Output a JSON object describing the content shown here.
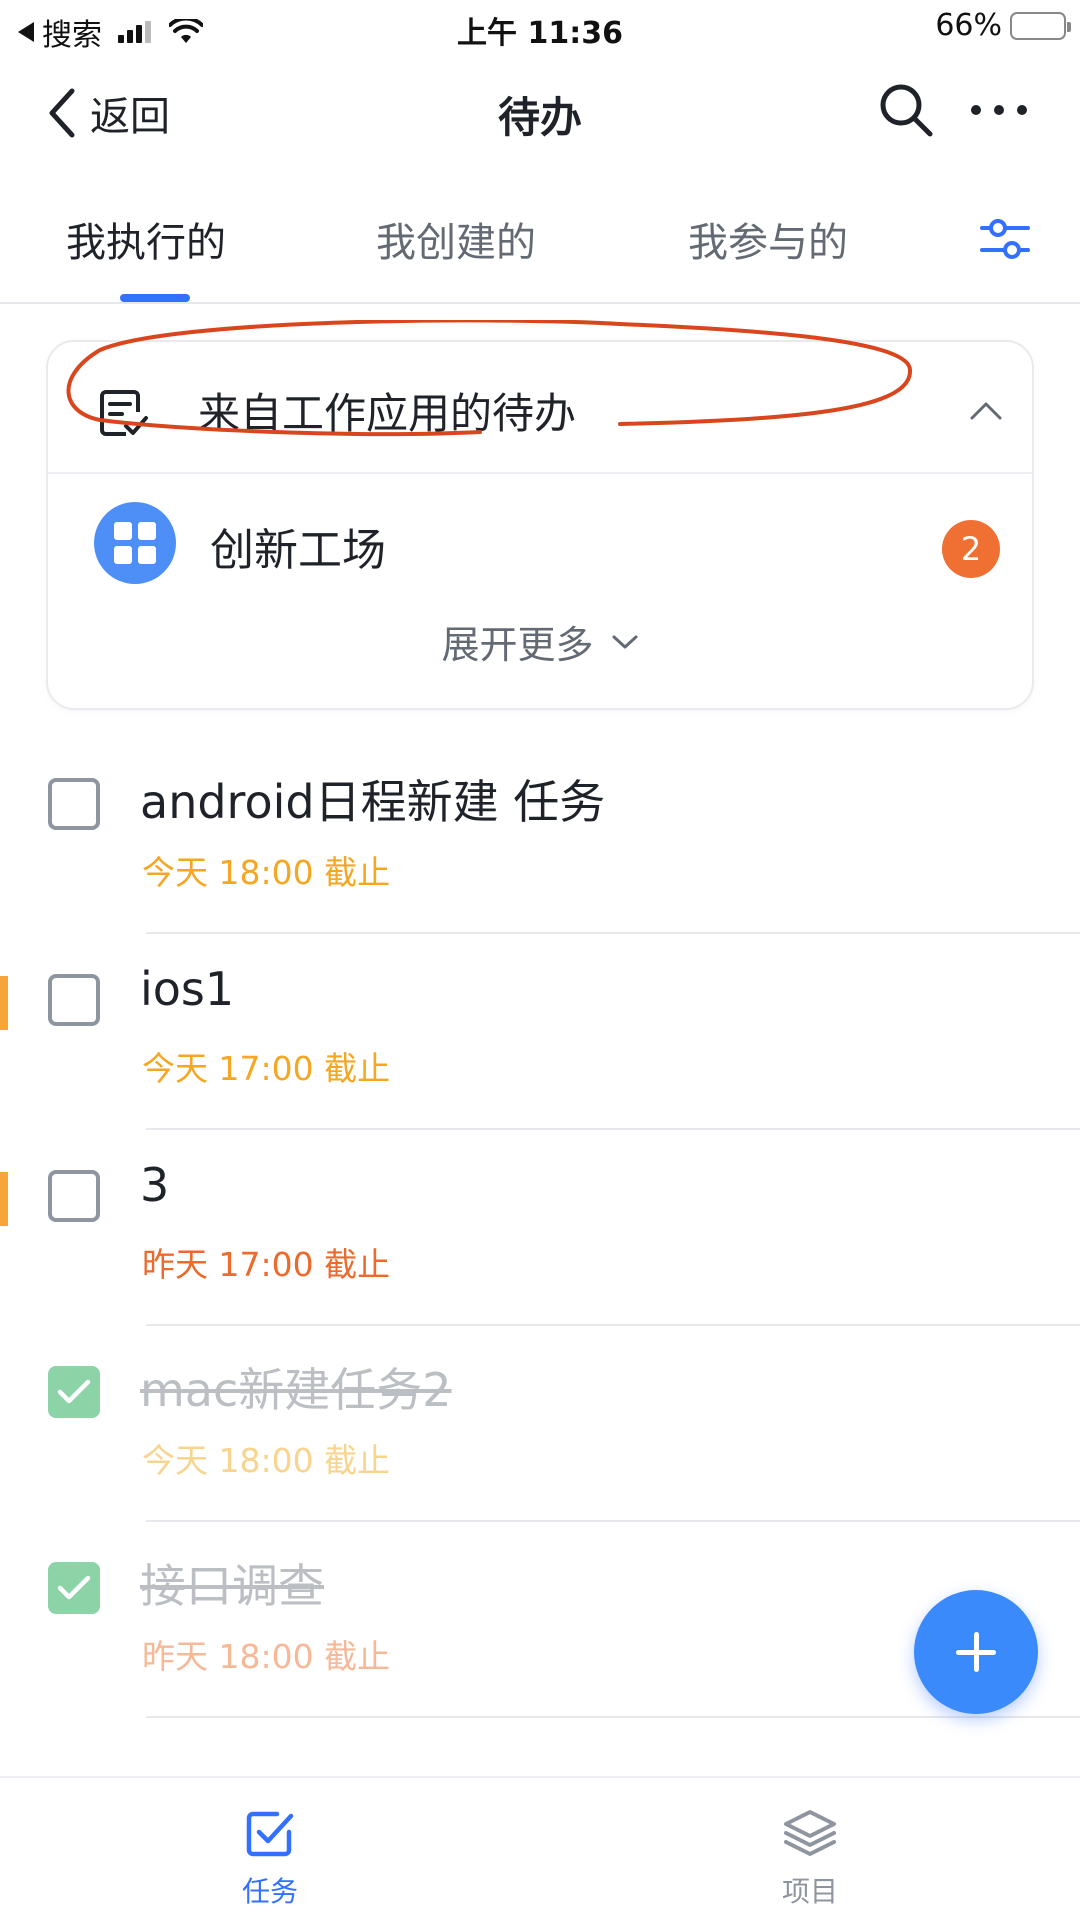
{
  "status_bar": {
    "back_app": "搜索",
    "time": "上午 11:36",
    "battery": "66%",
    "battery_level": 0.66
  },
  "nav": {
    "back_label": "返回",
    "title": "待办"
  },
  "tabs": [
    {
      "label": "我执行的",
      "active": true
    },
    {
      "label": "我创建的",
      "active": false
    },
    {
      "label": "我参与的",
      "active": false
    }
  ],
  "app_card": {
    "title": "来自工作应用的待办",
    "apps": [
      {
        "name": "创新工场",
        "badge": "2"
      }
    ],
    "expand_label": "展开更多"
  },
  "tasks": [
    {
      "title": "android日程新建 任务",
      "due": "今天 18:00 截止",
      "due_color": "#f5a623",
      "done": false,
      "flagged": false
    },
    {
      "title": "ios1",
      "due": "今天 17:00 截止",
      "due_color": "#f5a623",
      "done": false,
      "flagged": true
    },
    {
      "title": "3",
      "due": "昨天 17:00 截止",
      "due_color": "#ec6a2c",
      "done": false,
      "flagged": true
    },
    {
      "title": "mac新建任务2",
      "due": "今天 18:00 截止",
      "due_color": "#f9d48e",
      "done": true,
      "flagged": false
    },
    {
      "title": "接口调查",
      "due": "昨天 18:00 截止",
      "due_color": "#f6b896",
      "done": true,
      "flagged": false
    }
  ],
  "bottom_tabs": [
    {
      "label": "任务",
      "active": true,
      "color": "#3370ff"
    },
    {
      "label": "项目",
      "active": false,
      "color": "#8f959e"
    }
  ],
  "colors": {
    "accent": "#3370ff",
    "annotation": "#d9461e"
  }
}
